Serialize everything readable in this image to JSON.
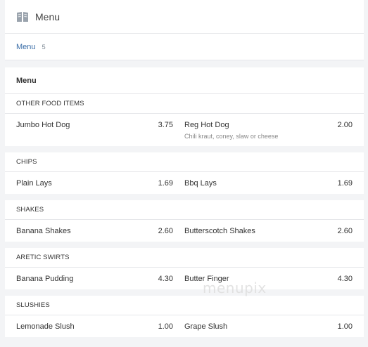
{
  "header": {
    "title": "Menu",
    "icon": "book-icon"
  },
  "tabs": [
    {
      "label": "Menu",
      "count": "5"
    }
  ],
  "section": {
    "title": "Menu"
  },
  "categories": [
    {
      "name": "OTHER FOOD ITEMS",
      "items": [
        {
          "name": "Jumbo Hot Dog",
          "price": "3.75",
          "description": ""
        },
        {
          "name": "Reg Hot Dog",
          "price": "2.00",
          "description": "Chili kraut, coney, slaw or cheese"
        }
      ]
    },
    {
      "name": "CHIPS",
      "items": [
        {
          "name": "Plain Lays",
          "price": "1.69",
          "description": ""
        },
        {
          "name": "Bbq Lays",
          "price": "1.69",
          "description": ""
        }
      ]
    },
    {
      "name": "SHAKES",
      "items": [
        {
          "name": "Banana Shakes",
          "price": "2.60",
          "description": ""
        },
        {
          "name": "Butterscotch Shakes",
          "price": "2.60",
          "description": ""
        }
      ]
    },
    {
      "name": "ARETIC SWIRTS",
      "items": [
        {
          "name": "Banana Pudding",
          "price": "4.30",
          "description": ""
        },
        {
          "name": "Butter Finger",
          "price": "4.30",
          "description": ""
        }
      ]
    },
    {
      "name": "SLUSHIES",
      "items": [
        {
          "name": "Lemonade Slush",
          "price": "1.00",
          "description": ""
        },
        {
          "name": "Grape Slush",
          "price": "1.00",
          "description": ""
        }
      ]
    }
  ],
  "watermark": "menupix"
}
